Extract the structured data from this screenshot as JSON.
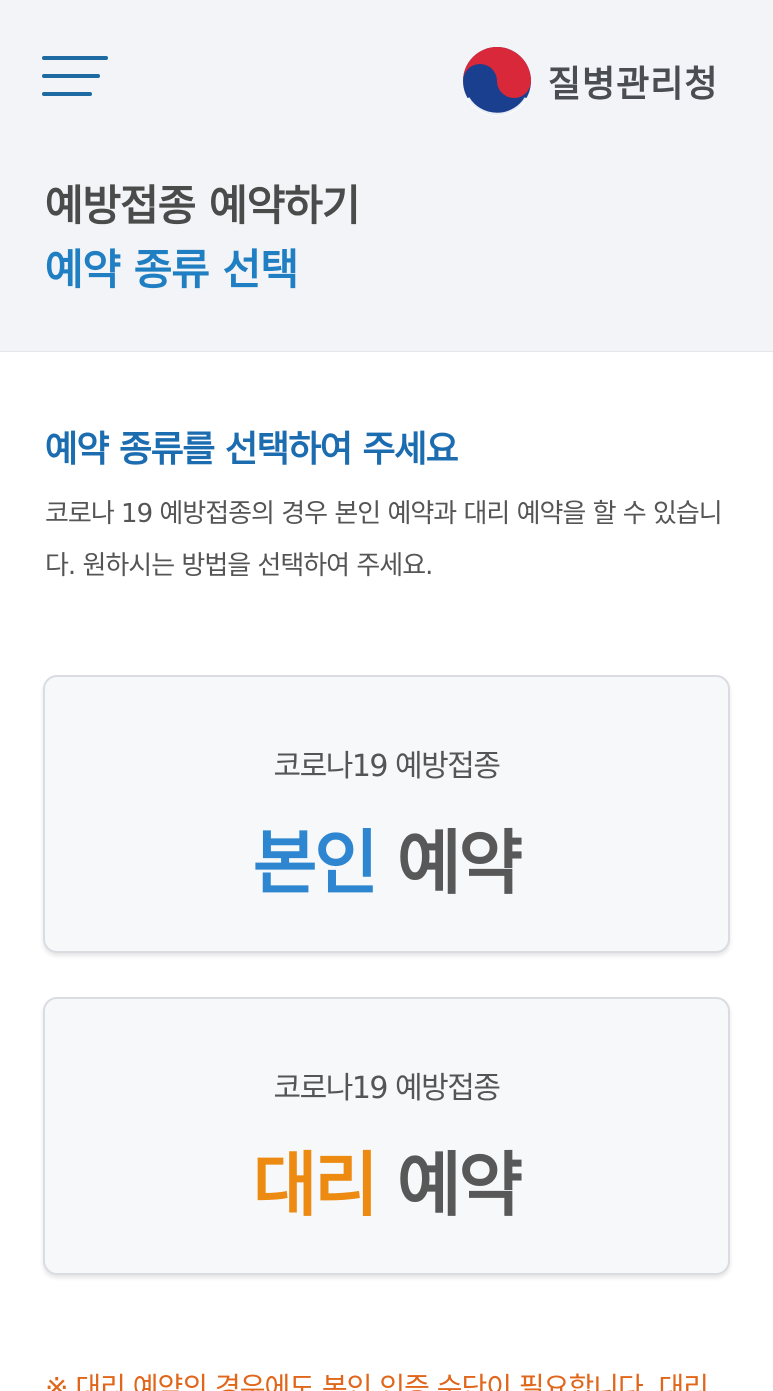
{
  "header": {
    "agency_name": "질병관리청",
    "title": "예방접종 예약하기",
    "subtitle": "예약 종류 선택"
  },
  "main": {
    "section_title": "예약 종류를 선택하여 주세요",
    "description": "코로나 19 예방접종의 경우 본인 예약과 대리 예약을 할 수 있습니다. 원하시는 방법을 선택하여 주세요."
  },
  "cards": [
    {
      "caption": "코로나19 예방접종",
      "highlight": "본인",
      "rest": " 예약",
      "highlight_color": "#2d86cf"
    },
    {
      "caption": "코로나19 예방접종",
      "highlight": "대리",
      "rest": " 예약",
      "highlight_color": "#ec8a12"
    }
  ],
  "footer_note": "※ 대리 예약의 경우에도 본인 인증 수단이 필요합니다. 대리",
  "colors": {
    "accent_blue": "#1f7fc2",
    "accent_orange": "#ec8a12",
    "header_bg": "#f2f4f7"
  }
}
